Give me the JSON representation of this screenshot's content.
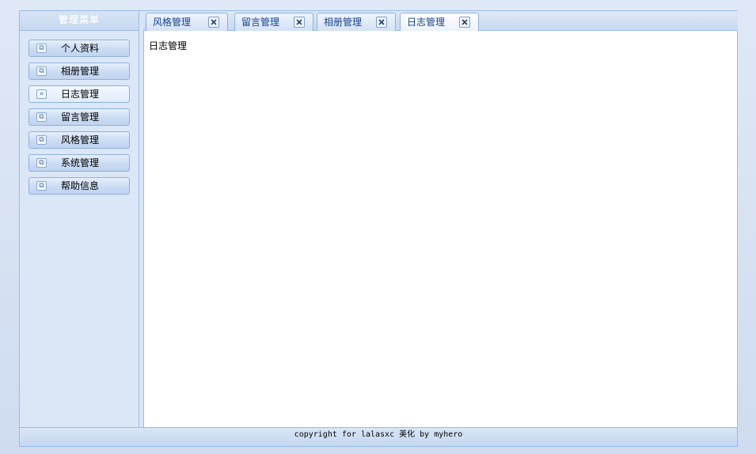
{
  "menu": {
    "title": "管理菜单",
    "items": [
      {
        "label": "个人资料",
        "icon": "window-icon",
        "glyph": "⧉"
      },
      {
        "label": "相册管理",
        "icon": "window-icon",
        "glyph": "⧉"
      },
      {
        "label": "日志管理",
        "icon": "double-chevron-right-icon",
        "glyph": "»"
      },
      {
        "label": "留言管理",
        "icon": "window-icon",
        "glyph": "⧉"
      },
      {
        "label": "风格管理",
        "icon": "window-icon",
        "glyph": "⧉"
      },
      {
        "label": "系统管理",
        "icon": "window-icon",
        "glyph": "⧉"
      },
      {
        "label": "帮助信息",
        "icon": "window-icon",
        "glyph": "⧉"
      }
    ],
    "active_index": 2
  },
  "tabs": {
    "items": [
      {
        "label": "风格管理"
      },
      {
        "label": "留言管理"
      },
      {
        "label": "相册管理"
      },
      {
        "label": "日志管理"
      }
    ],
    "active_index": 3
  },
  "content": {
    "text": "日志管理"
  },
  "footer": {
    "text": "copyright for lalasxc 美化 by myhero"
  },
  "colors": {
    "border": "#99bbe8",
    "tab_text": "#15428b",
    "panel_bg": "#dbe7f7"
  }
}
